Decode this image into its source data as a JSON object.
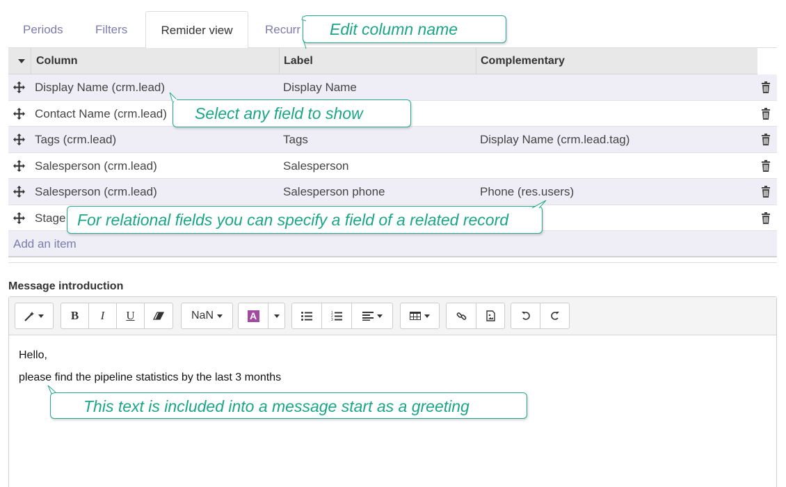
{
  "tabs": [
    "Periods",
    "Filters",
    "Remider view",
    "Recurr"
  ],
  "table": {
    "headers": {
      "column": "Column",
      "label": "Label",
      "complementary": "Complementary"
    },
    "rows": [
      {
        "column": "Display Name (crm.lead)",
        "label": "Display Name",
        "complementary": ""
      },
      {
        "column": "Contact Name (crm.lead)",
        "label": "",
        "complementary": ""
      },
      {
        "column": "Tags (crm.lead)",
        "label": "Tags",
        "complementary": "Display Name (crm.lead.tag)"
      },
      {
        "column": "Salesperson (crm.lead)",
        "label": "Salesperson",
        "complementary": ""
      },
      {
        "column": "Salesperson (crm.lead)",
        "label": "Salesperson phone",
        "complementary": "Phone (res.users)"
      },
      {
        "column": "Stage",
        "label": "",
        "complementary": ""
      }
    ],
    "add_item": "Add an item"
  },
  "message": {
    "label": "Message introduction",
    "font_size": "NaN",
    "body": [
      "Hello,",
      "please find the pipeline statistics by the last 3 months"
    ]
  },
  "toolbar": {
    "bold": "B",
    "italic": "I",
    "underline": "U",
    "color_letter": "A"
  },
  "callouts": {
    "edit_column": "Edit column name",
    "select_field": "Select any field to show",
    "relational": "For relational fields you can specify a field of a related record",
    "greeting": "This text is included into a message start as a greeting"
  },
  "colors": {
    "accent": "#7c7bad",
    "callout": "#1aa686",
    "row_alt": "#efeef7"
  }
}
